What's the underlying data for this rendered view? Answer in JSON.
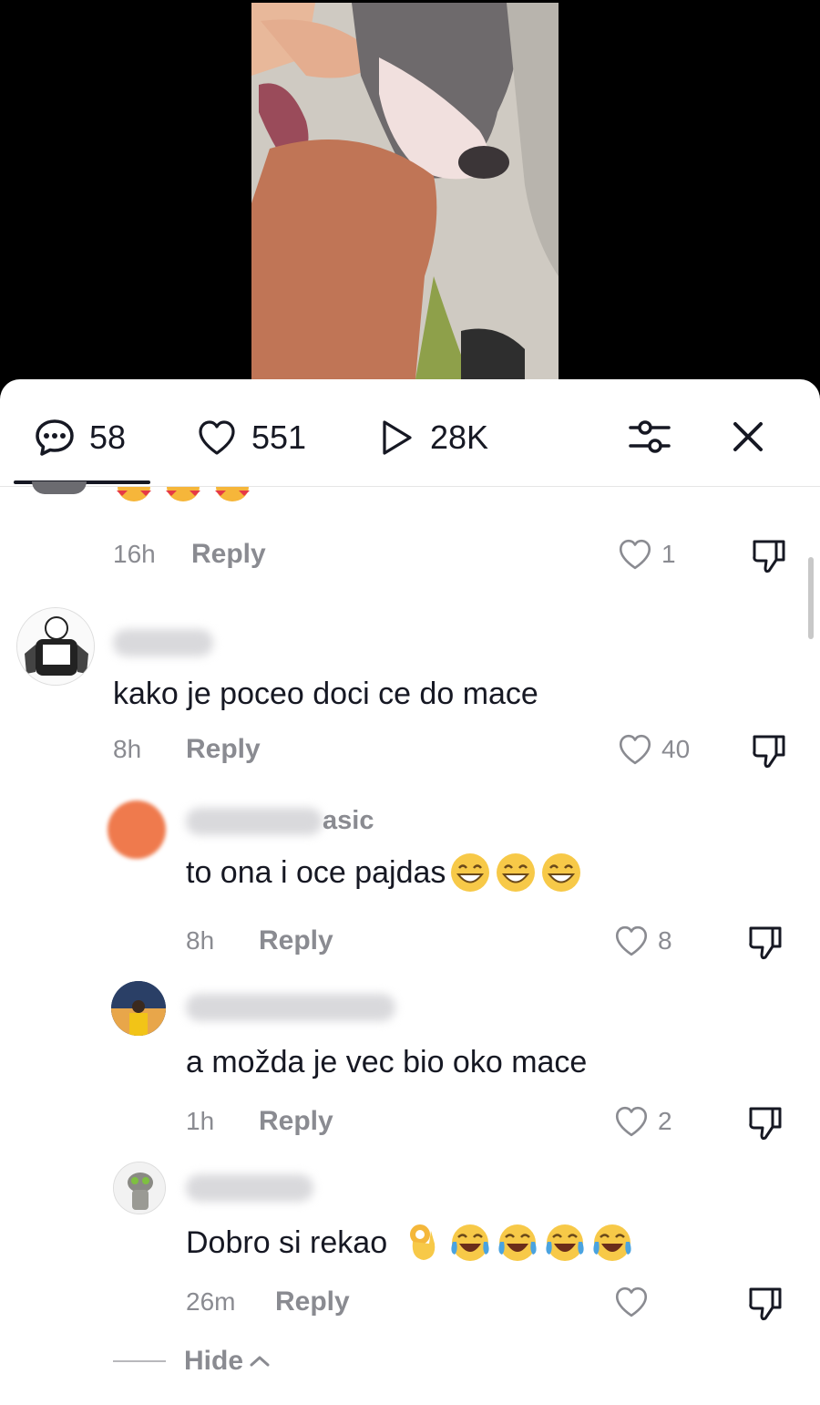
{
  "stats": {
    "comments": "58",
    "likes": "551",
    "views": "28K"
  },
  "comments": [
    {
      "time": "16h",
      "reply": "Reply",
      "likes": "1"
    },
    {
      "username": "",
      "text": "kako je poceo doci ce do mace",
      "time": "8h",
      "reply": "Reply",
      "likes": "40"
    },
    {
      "username": "asic",
      "text": "to ona i oce pajdas",
      "time": "8h",
      "reply": "Reply",
      "likes": "8"
    },
    {
      "username": "",
      "text": "a možda je vec bio oko mace",
      "time": "1h",
      "reply": "Reply",
      "likes": "2"
    },
    {
      "username": "",
      "text": "Dobro si rekao",
      "time": "26m",
      "reply": "Reply",
      "likes": ""
    }
  ],
  "hide_label": "Hide",
  "icons": {
    "comments": "chat-bubble-icon",
    "likes": "heart-outline-icon",
    "views": "play-icon",
    "filter": "sliders-icon",
    "close": "close-icon",
    "dislike": "thumbs-down-icon"
  },
  "colors": {
    "text": "#161823",
    "muted": "#8a8b91",
    "background": "#ffffff"
  }
}
